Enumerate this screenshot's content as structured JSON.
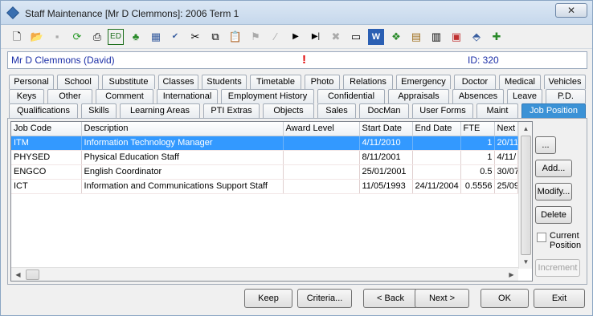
{
  "window": {
    "title": "Staff Maintenance  [Mr D Clemmons]:  2006 Term 1",
    "close_label": "✕"
  },
  "toolbar": {
    "icons": [
      "new-document-icon",
      "open-folder-icon",
      "save-icon",
      "refresh-icon",
      "print-icon",
      "ed-icon",
      "tree-icon",
      "calculator-icon",
      "spellcheck-icon",
      "cut-icon",
      "copy-icon",
      "paste-icon",
      "flag-icon",
      "line-icon",
      "play-icon",
      "next-end-icon",
      "delete-icon",
      "card-icon",
      "word-icon",
      "excel-icon",
      "clipboard-icon",
      "calendar-icon",
      "calendar-delete-icon",
      "tag-icon",
      "add-document-icon"
    ],
    "ed_label": "ED"
  },
  "staff": {
    "name": "Mr D Clemmons (David)",
    "alert": "!",
    "id": "ID: 320"
  },
  "tabs": {
    "row1": [
      "Personal",
      "School",
      "Substitute",
      "Classes",
      "Students",
      "Timetable",
      "Photo",
      "Relations",
      "Emergency",
      "Doctor",
      "Medical",
      "Vehicles"
    ],
    "row2": [
      "Keys",
      "Other",
      "Comment",
      "International",
      "Employment History",
      "Confidential",
      "Appraisals",
      "Absences",
      "Leave",
      "P.D."
    ],
    "row3": [
      "Qualifications",
      "Skills",
      "Learning Areas",
      "PTI Extras",
      "Objects",
      "Sales",
      "DocMan",
      "User Forms",
      "Maint",
      "Job Position"
    ],
    "active": "Job Position"
  },
  "grid": {
    "columns": [
      "Job Code",
      "Description",
      "Award Level",
      "Start Date",
      "End Date",
      "FTE",
      "Next"
    ],
    "rows": [
      {
        "code": "ITM",
        "description": "Information Technology Manager",
        "award": "",
        "start": "4/11/2010",
        "end": "",
        "fte": "1",
        "next": "20/11"
      },
      {
        "code": "PHYSED",
        "description": "Physical Education Staff",
        "award": "",
        "start": "8/11/2001",
        "end": "",
        "fte": "1",
        "next": "4/11/"
      },
      {
        "code": "ENGCO",
        "description": "English Coordinator",
        "award": "",
        "start": "25/01/2001",
        "end": "",
        "fte": "0.5",
        "next": "30/07"
      },
      {
        "code": "ICT",
        "description": "Information and Communications Support Staff",
        "award": "",
        "start": "11/05/1993",
        "end": "24/11/2004",
        "fte": "0.5556",
        "next": "25/09"
      }
    ],
    "selected_index": 0
  },
  "side_buttons": {
    "more": "...",
    "add": "Add...",
    "modify": "Modify...",
    "delete": "Delete",
    "current_position": "Current Position",
    "increment": "Increment"
  },
  "bottom_buttons": {
    "keep": "Keep",
    "criteria": "Criteria...",
    "back": "< Back",
    "next": "Next >",
    "ok": "OK",
    "exit": "Exit"
  },
  "colors": {
    "selection": "#3399ff",
    "active_tab": "#3b92d6",
    "staff_name": "#1b2ea7",
    "alert": "#e00000"
  }
}
